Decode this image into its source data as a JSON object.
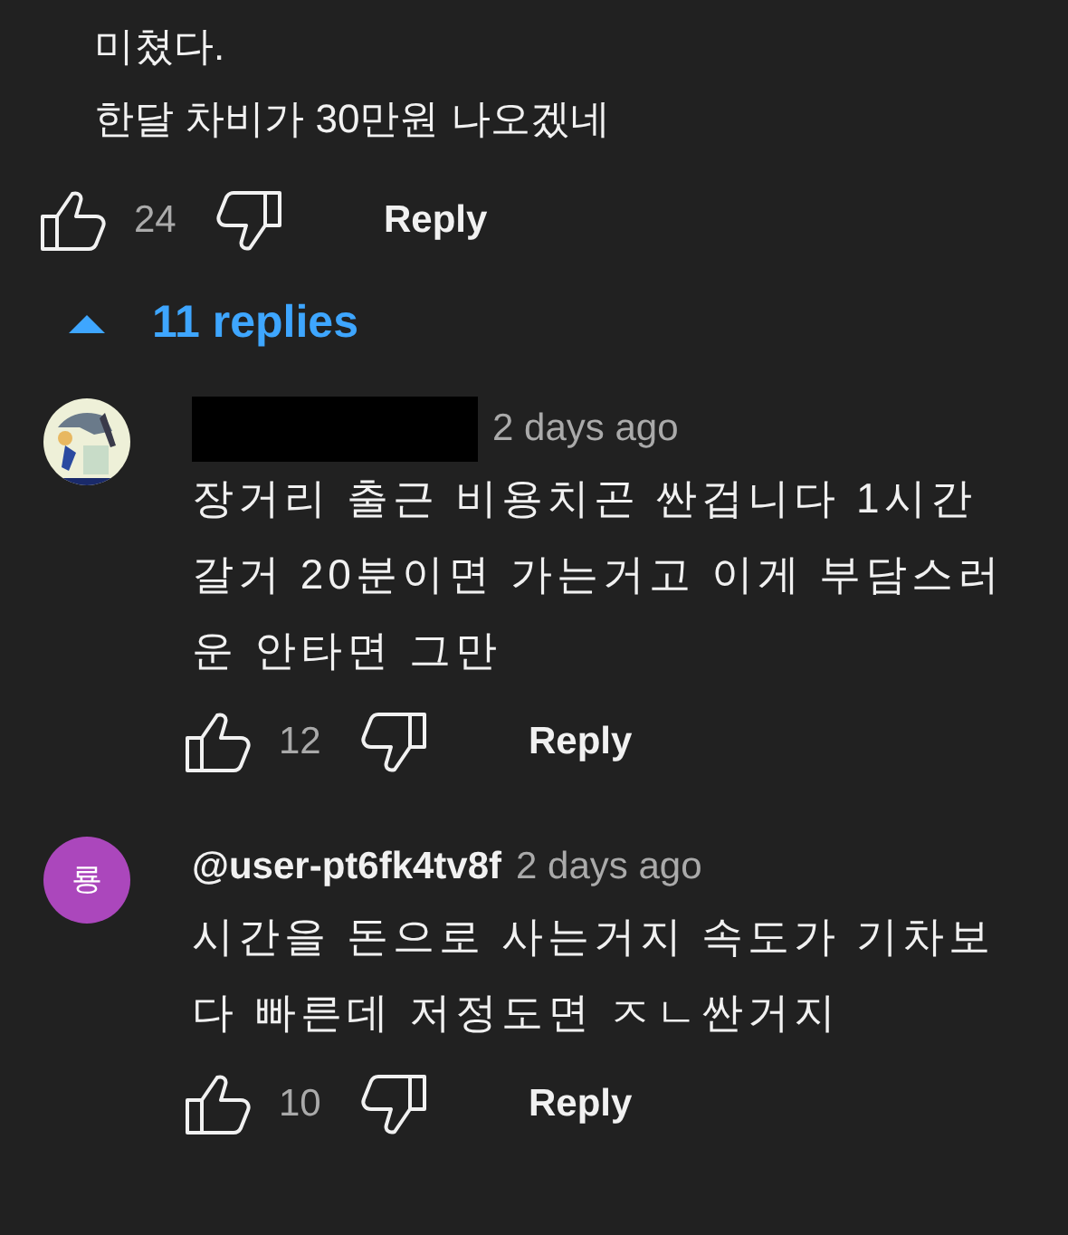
{
  "comment": {
    "lines": [
      "미쳤다.",
      "한달 차비가 30만원 나오겠네"
    ],
    "likes": "24",
    "reply_label": "Reply"
  },
  "replies_toggle": {
    "expanded": true,
    "label": "11 replies"
  },
  "replies": [
    {
      "author_redacted": true,
      "time": "2 days ago",
      "text": "장거리 출근 비용치곤 싼겁니다 1시간 갈거 20분이면 가는거고 이게 부담스러운 안타면 그만",
      "likes": "12",
      "reply_label": "Reply"
    },
    {
      "avatar": {
        "kind": "letter",
        "letter": "룡",
        "color": "#ab47bc"
      },
      "author": "@user-pt6fk4tv8f",
      "time": "2 days ago",
      "text": "시간을 돈으로 사는거지 속도가 기차보다 빠른데 저정도면 ㅈㄴ싼거지",
      "likes": "10",
      "reply_label": "Reply"
    }
  ]
}
